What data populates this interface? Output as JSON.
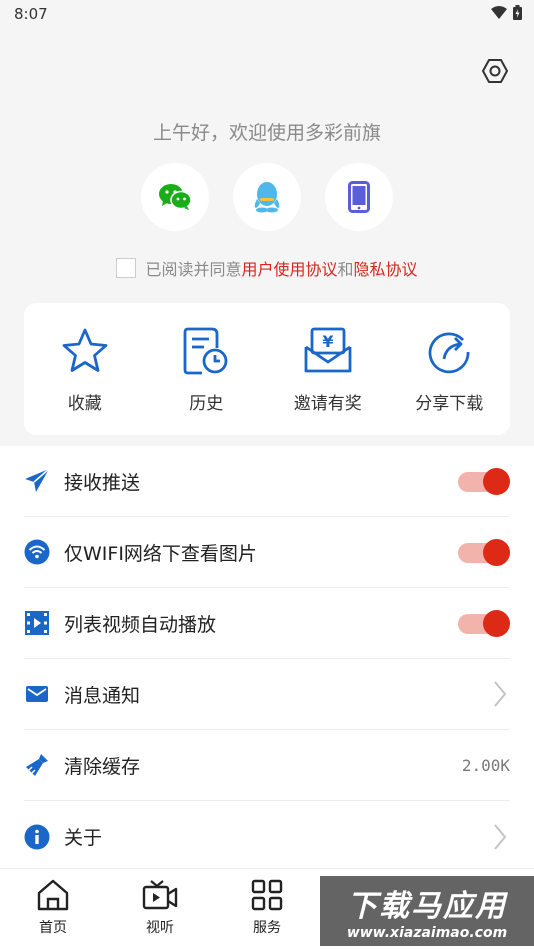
{
  "status_bar": {
    "time": "8:07"
  },
  "greeting": "上午好，欢迎使用多彩前旗",
  "login_options": [
    {
      "icon": "wechat-icon",
      "color": "#1aad19"
    },
    {
      "icon": "qq-icon",
      "color": "#4fb8ea"
    },
    {
      "icon": "phone-icon",
      "color": "#5a5fd8"
    }
  ],
  "agreement": {
    "prefix": "已阅读并同意",
    "user_agreement": "用户使用协议",
    "and": "和",
    "privacy_agreement": "隐私协议"
  },
  "quick_actions": [
    {
      "label": "收藏",
      "icon": "star-icon"
    },
    {
      "label": "历史",
      "icon": "history-icon"
    },
    {
      "label": "邀请有奖",
      "icon": "invite-reward-icon"
    },
    {
      "label": "分享下载",
      "icon": "share-icon"
    }
  ],
  "settings": {
    "push": {
      "label": "接收推送",
      "on": true
    },
    "wifi_images": {
      "label": "仅WIFI网络下查看图片",
      "on": true
    },
    "autoplay": {
      "label": "列表视频自动播放",
      "on": true
    },
    "notifications": {
      "label": "消息通知"
    },
    "clear_cache": {
      "label": "清除缓存",
      "value": "2.00K"
    },
    "about": {
      "label": "关于"
    }
  },
  "tabbar": [
    {
      "label": "首页",
      "icon": "home-icon"
    },
    {
      "label": "视听",
      "icon": "video-icon"
    },
    {
      "label": "服务",
      "icon": "grid-icon"
    }
  ],
  "watermark": {
    "title": "下载马应用",
    "url": "www.xiazaimao.com"
  },
  "colors": {
    "accent": "#dc2a17",
    "icon_blue": "#1a66c9",
    "link_red": "#d6261e"
  }
}
